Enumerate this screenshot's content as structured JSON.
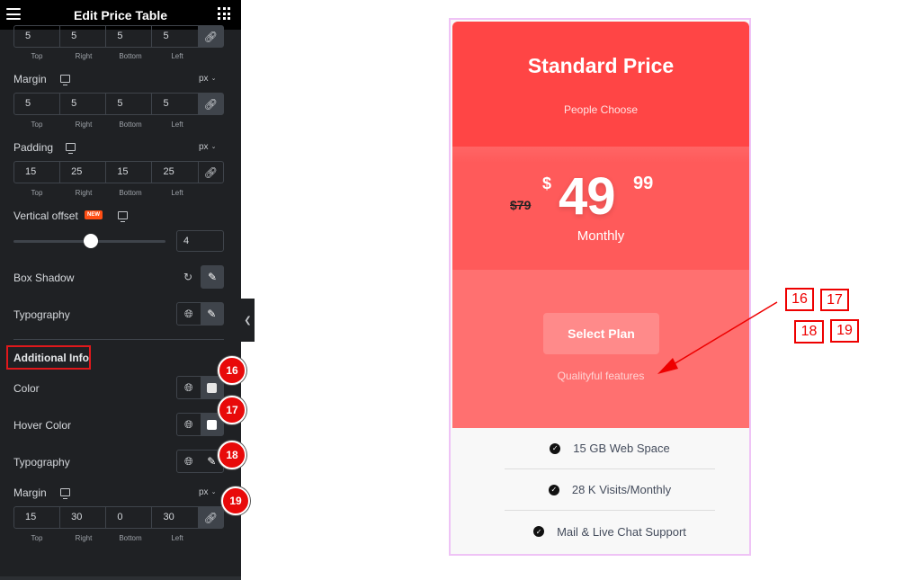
{
  "panel": {
    "title": "Edit Price Table",
    "menu_icon": "hamburger-icon",
    "apps_icon": "grid-icon",
    "border_radius_values": {
      "top": "5",
      "right": "5",
      "bottom": "5",
      "left": "5"
    },
    "dim_labels": {
      "top": "Top",
      "right": "Right",
      "bottom": "Bottom",
      "left": "Left"
    },
    "margin": {
      "label": "Margin",
      "unit": "px",
      "top": "5",
      "right": "5",
      "bottom": "5",
      "left": "5"
    },
    "padding": {
      "label": "Padding",
      "unit": "px",
      "top": "15",
      "right": "25",
      "bottom": "15",
      "left": "25"
    },
    "vertical_offset": {
      "label": "Vertical offset",
      "badge": "NEW",
      "value": "4",
      "slider_fraction": 0.5
    },
    "box_shadow": {
      "label": "Box Shadow"
    },
    "typography": {
      "label": "Typography"
    },
    "additional_info": {
      "section_title": "Additional Info",
      "color": {
        "label": "Color",
        "swatch": "#e6e6e6"
      },
      "hover_color": {
        "label": "Hover Color",
        "swatch": "#ffffff"
      },
      "typography": {
        "label": "Typography"
      },
      "margin": {
        "label": "Margin",
        "unit": "px",
        "top": "15",
        "right": "30",
        "bottom": "0",
        "left": "30"
      }
    },
    "callouts": [
      "16",
      "17",
      "18",
      "19"
    ]
  },
  "price_table": {
    "title": "Standard Price",
    "subtitle": "People Choose",
    "old_price": "$79",
    "currency": "$",
    "amount": "49",
    "cents": "99",
    "period": "Monthly",
    "button": "Select Plan",
    "additional_info": "Qualityful features",
    "features": [
      "15 GB Web Space",
      "28 K Visits/Monthly",
      "Mail & Live Chat Support"
    ],
    "colors": {
      "header": "#ff4545",
      "price": "#ff5a5a",
      "footer": "#ff7070",
      "button": "#ff8a8a"
    }
  },
  "annotations": [
    "16",
    "17",
    "18",
    "19"
  ]
}
